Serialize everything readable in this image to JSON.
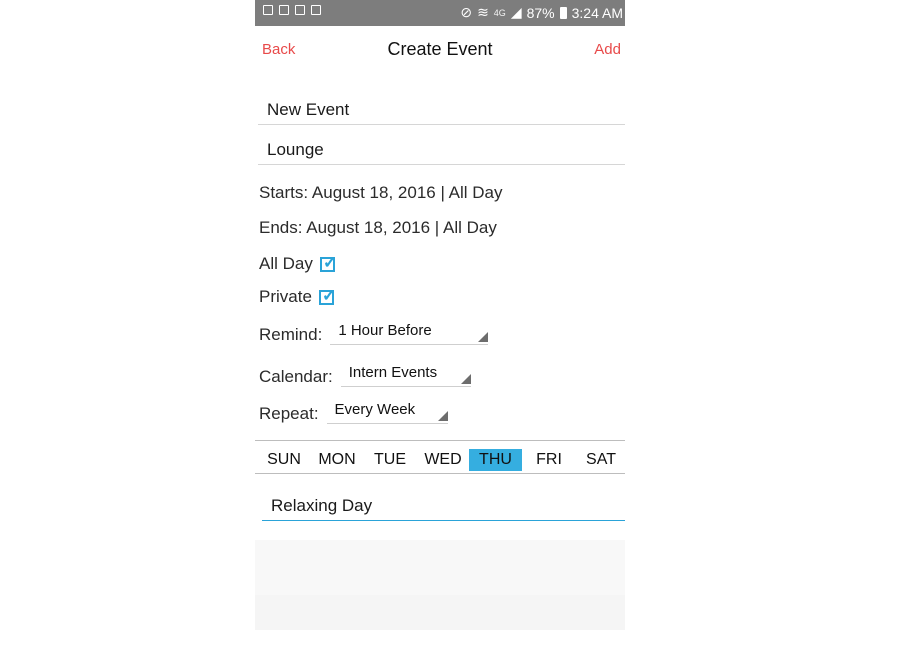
{
  "status_bar": {
    "network_label": "4G",
    "battery": "87%",
    "time": "3:24 AM"
  },
  "header": {
    "back_label": "Back",
    "title": "Create Event",
    "add_label": "Add"
  },
  "form": {
    "event_name": "New Event",
    "location": "Lounge",
    "starts": "Starts: August 18, 2016 | All Day",
    "ends": "Ends: August 18, 2016 | All Day",
    "all_day_label": "All Day",
    "all_day_checked": true,
    "private_label": "Private",
    "private_checked": true,
    "remind_label": "Remind:",
    "remind_value": "1 Hour Before",
    "calendar_label": "Calendar:",
    "calendar_value": "Intern Events",
    "repeat_label": "Repeat:",
    "repeat_value": "Every Week",
    "notes": "Relaxing Day"
  },
  "days": {
    "items": [
      "SUN",
      "MON",
      "TUE",
      "WED",
      "THU",
      "FRI",
      "SAT"
    ],
    "selected": "THU"
  },
  "colors": {
    "accent_red": "#e84a4a",
    "accent_blue": "#35aee0",
    "status_bar": "#7d7d7d"
  }
}
